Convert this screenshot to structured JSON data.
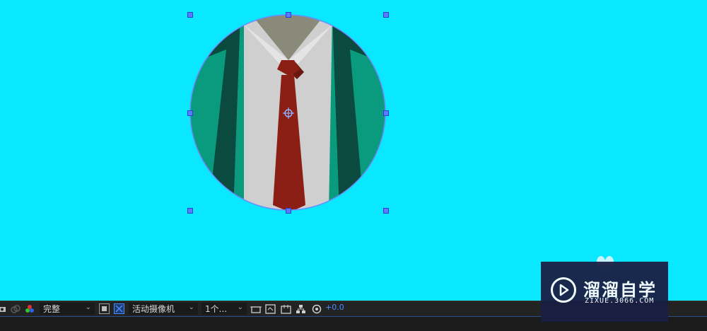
{
  "canvas": {
    "background_color": "#0ae8ff",
    "layer_name": "suit-tie-illustration"
  },
  "colors": {
    "jacket_dark": "#0b4a3e",
    "jacket_light": "#0a9b7e",
    "shirt": "#cfcfcf",
    "collar_shadow": "#8a8a7a",
    "tie": "#8b1f15",
    "handle": "#5b7cff",
    "accent_blue": "#4a8bff"
  },
  "toolbar": {
    "camera_icon": "camera-icon",
    "color_icon": "rgb-channels-icon",
    "resolution": "完整",
    "camera_view": "活动摄像机",
    "view_layout": "1个...",
    "exposure": "+0.0"
  },
  "watermark": {
    "title": "溜溜自学",
    "subtitle": "ZIXUE.3066.COM",
    "logo_icon": "play-logo-icon"
  }
}
